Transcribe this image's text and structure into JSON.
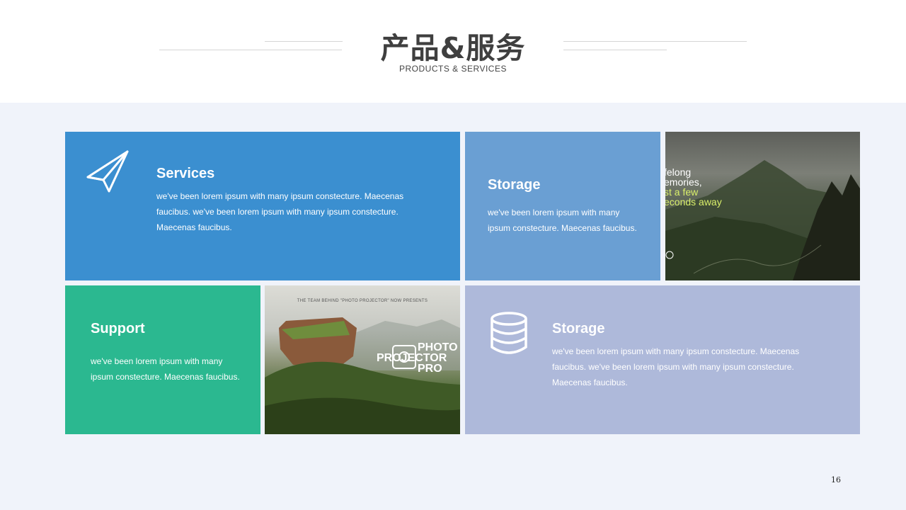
{
  "header": {
    "title": "产品&服务",
    "subtitle": "PRODUCTS & SERVICES"
  },
  "cards": {
    "services": {
      "icon": "paper-plane-icon",
      "title": "Services",
      "text": "we've  been lorem ipsum with many ipsum constecture. Maecenas faucibus. we've been lorem ipsum with many ipsum constecture. Maecenas faucibus."
    },
    "storage_top": {
      "title": "Storage",
      "text": "we've  been lorem ipsum with many ipsum constecture. Maecenas faucibus."
    },
    "support": {
      "title": "Support",
      "text": "we've  been lorem ipsum with many ipsum constecture. Maecenas faucibus."
    },
    "storage_bottom": {
      "icon": "database-icon",
      "title": "Storage",
      "text": "we've  been lorem ipsum with many ipsum constecture. Maecenas faucibus. we've been lorem ipsum with many ipsum constecture. Maecenas faucibus."
    }
  },
  "photos": {
    "mountain": {
      "text_lines": [
        "felong",
        "emories,",
        "st a few",
        "econds away"
      ]
    },
    "rock": {
      "caption": "THE TEAM BEHIND \"PHOTO PROJECTOR\" NOW PRESENTS",
      "logo_lines": [
        "PHOTO",
        "PROJECTOR",
        "PRO"
      ]
    }
  },
  "footer": {
    "page_number": "16"
  },
  "colors": {
    "services_bg": "#3b8fd0",
    "storage_top_bg": "#6a9fd3",
    "support_bg": "#2bb890",
    "storage_bottom_bg": "#aeb9da",
    "page_bg": "#f0f3fa"
  }
}
